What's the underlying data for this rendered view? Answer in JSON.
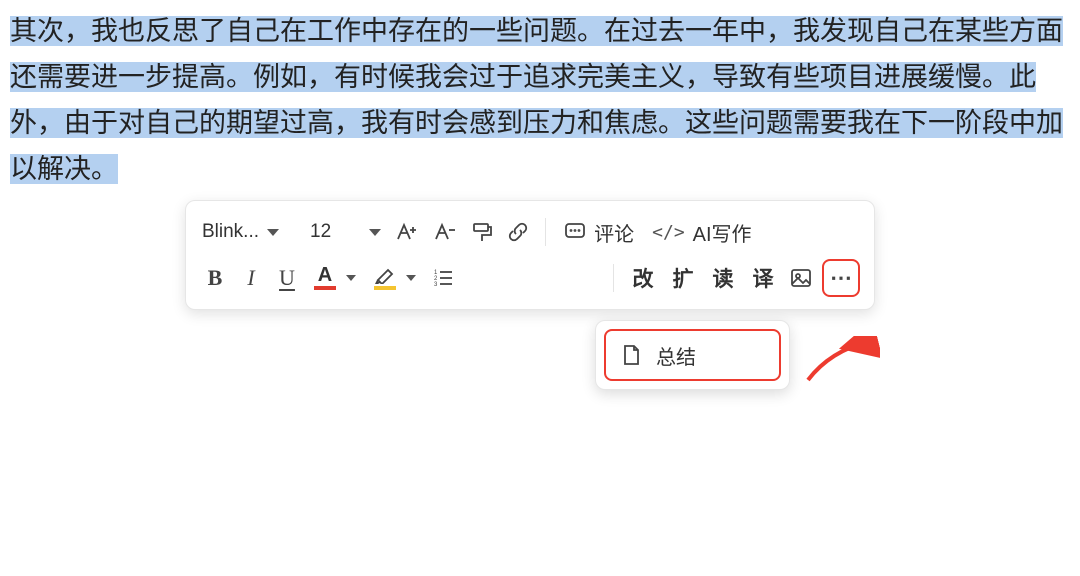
{
  "document": {
    "text": "其次，我也反思了自己在工作中存在的一些问题。在过去一年中，我发现自己在某些方面还需要进一步提高。例如，有时候我会过于追求完美主义，导致有些项目进展缓慢。此外，由于对自己的期望过高，我有时会感到压力和焦虑。这些问题需要我在下一阶段中加以解决。"
  },
  "toolbar": {
    "font_name": "Blink...",
    "font_size": "12",
    "comment_label": "评论",
    "ai_write_label": "AI写作",
    "cn_buttons": [
      "改",
      "扩",
      "读",
      "译"
    ]
  },
  "dropdown": {
    "summary_label": "总结"
  },
  "colors": {
    "annotation_red": "#ed3b2f",
    "text_red": "#e23b2e",
    "highlight_yellow": "#f4c430",
    "selection_blue": "#b4d0f0"
  }
}
